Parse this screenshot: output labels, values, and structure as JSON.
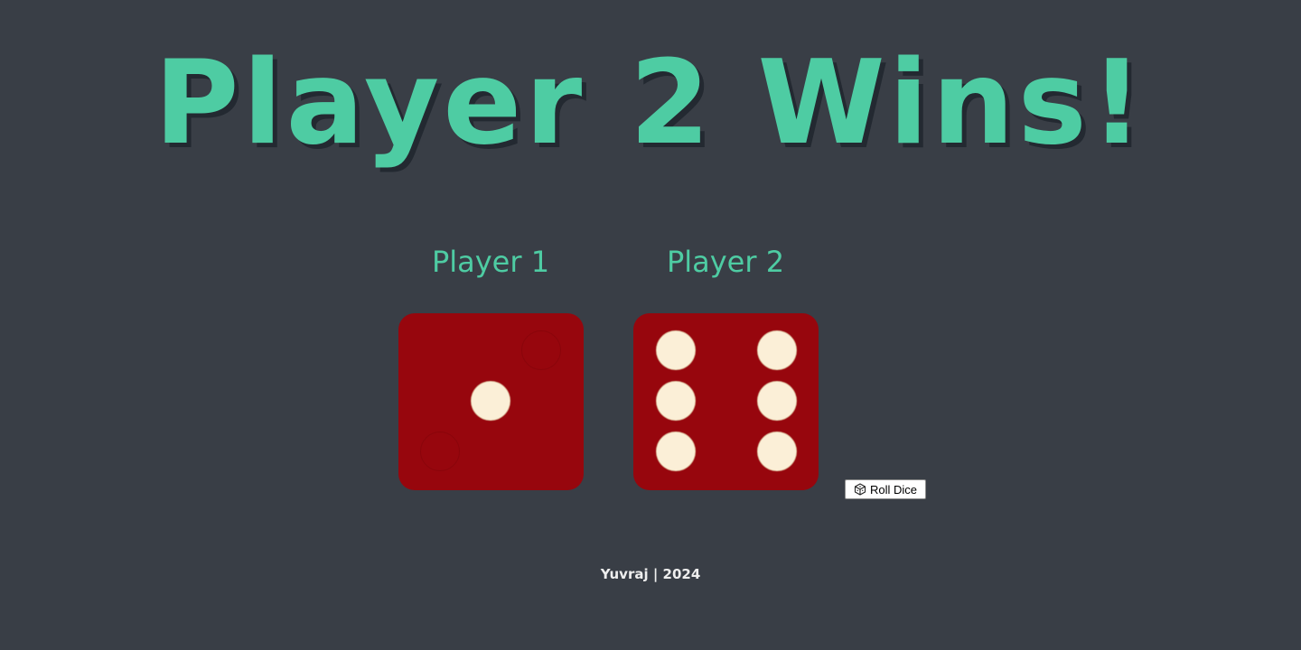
{
  "headline": "Player 2 Wins!",
  "players": [
    {
      "name": "Player 1",
      "die_value": 1
    },
    {
      "name": "Player 2",
      "die_value": 6
    }
  ],
  "roll_button": {
    "label": "Roll Dice",
    "icon": "dice-icon"
  },
  "footer": "Yuvraj | 2024",
  "colors": {
    "background": "#393e46",
    "accent": "#4ecca3",
    "die_face": "#97060d",
    "pip": "#fbefd7",
    "footer_text": "#eeeeee"
  }
}
